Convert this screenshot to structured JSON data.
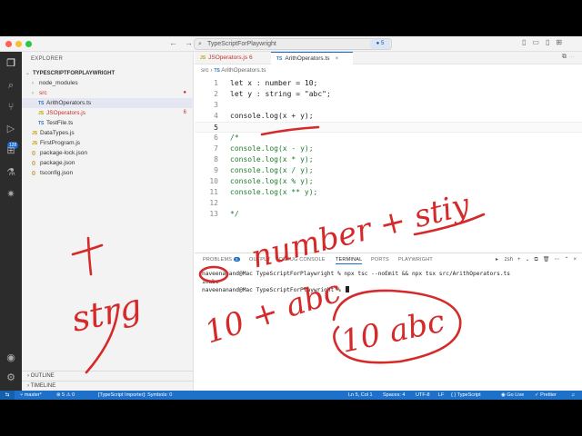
{
  "window": {
    "search_text": "TypeScriptForPlaywright",
    "session_count": "5"
  },
  "activity_bar": {
    "source_control_badge": "128"
  },
  "explorer": {
    "header": "EXPLORER",
    "project": "TYPESCRIPTFORPLAYWRIGHT",
    "items": [
      {
        "label": "node_modules",
        "kind": "folder",
        "indent": 1,
        "status": ""
      },
      {
        "label": "src",
        "kind": "folder",
        "indent": 1,
        "status": "dot"
      },
      {
        "label": "ArithOperators.ts",
        "kind": "ts",
        "indent": 2,
        "status": ""
      },
      {
        "label": "JSOperators.js",
        "kind": "js",
        "indent": 2,
        "status": "6"
      },
      {
        "label": "TestFile.ts",
        "kind": "ts",
        "indent": 2,
        "status": ""
      },
      {
        "label": "DataTypes.js",
        "kind": "js",
        "indent": 1,
        "status": ""
      },
      {
        "label": "FirstProgram.js",
        "kind": "js",
        "indent": 1,
        "status": ""
      },
      {
        "label": "package-lock.json",
        "kind": "json",
        "indent": 1,
        "status": ""
      },
      {
        "label": "package.json",
        "kind": "json",
        "indent": 1,
        "status": ""
      },
      {
        "label": "tsconfig.json",
        "kind": "json",
        "indent": 1,
        "status": ""
      }
    ],
    "outline": "OUTLINE",
    "timeline": "TIMELINE"
  },
  "tabs": [
    {
      "label": "JSOperators.js",
      "badge": "6"
    },
    {
      "label": "ArithOperators.ts",
      "close": "×"
    }
  ],
  "breadcrumb": {
    "folder": "src",
    "file": "ArithOperators.ts"
  },
  "code": [
    {
      "n": "1",
      "text": "let x : number = 10;"
    },
    {
      "n": "2",
      "text": "let y : string = \"abc\";"
    },
    {
      "n": "3",
      "text": ""
    },
    {
      "n": "4",
      "text": "console.log(x + y);"
    },
    {
      "n": "5",
      "text": ""
    },
    {
      "n": "6",
      "text": "/*"
    },
    {
      "n": "7",
      "text": "console.log(x - y);"
    },
    {
      "n": "8",
      "text": "console.log(x * y);"
    },
    {
      "n": "9",
      "text": "console.log(x / y);"
    },
    {
      "n": "10",
      "text": "console.log(x % y);"
    },
    {
      "n": "11",
      "text": "console.log(x ** y);"
    },
    {
      "n": "12",
      "text": ""
    },
    {
      "n": "13",
      "text": "*/"
    }
  ],
  "panel": {
    "tabs": [
      "PROBLEMS",
      "OUTPUT",
      "DEBUG CONSOLE",
      "TERMINAL",
      "PORTS",
      "PLAYWRIGHT"
    ],
    "problems_badge": "5",
    "shell": "zsh",
    "terminal_lines": [
      "naveenanand@Mac TypeScriptForPlaywright % npx tsc --noEmit && npx tsx src/ArithOperators.ts",
      "10abc",
      "naveenanand@Mac TypeScriptForPlaywright % "
    ]
  },
  "status_bar": {
    "branch": "master*",
    "problems": "⊗ 5 ⚠ 0",
    "importer": "[TypeScript Importer]: Symbols: 0",
    "position": "Ln 5, Col 1",
    "spaces": "Spaces: 4",
    "encoding": "UTF-8",
    "eol": "LF",
    "language": "TypeScript",
    "golive": "Go Live",
    "prettier": "✓ Prettier"
  },
  "annotations": [
    "+",
    "strg",
    "number + stiy",
    "10 + abc",
    "10 abc"
  ],
  "colors": {
    "ink": "#d42a2a",
    "status_blue": "#1e70c8",
    "accent": "#1b6ac9"
  }
}
